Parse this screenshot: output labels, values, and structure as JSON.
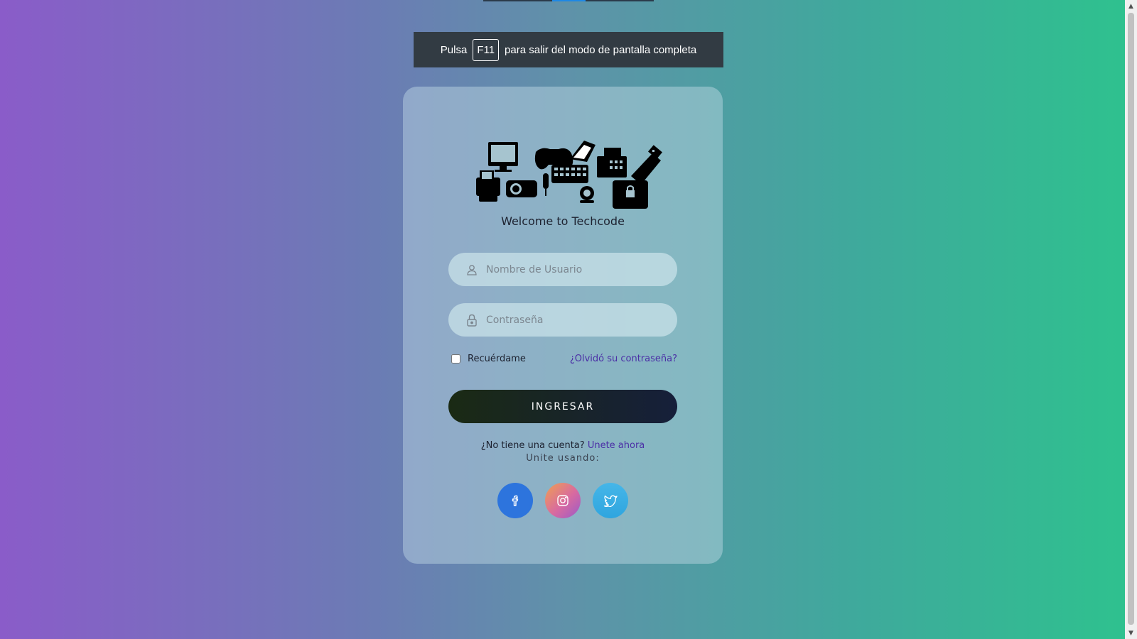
{
  "fullscreen_banner": {
    "prefix": "Pulsa",
    "key": "F11",
    "suffix": "para salir del modo de pantalla completa"
  },
  "login": {
    "welcome": "Welcome to Techcode",
    "username_placeholder": "Nombre de Usuario",
    "password_placeholder": "Contraseña",
    "remember_label": "Recuérdame",
    "remember_checked": false,
    "forgot_link": "¿Olvidó su contraseña?",
    "submit_label": "INGRESAR",
    "no_account_text": "¿No tiene una cuenta?",
    "join_link": "Unete ahora",
    "join_using": "Unite usando:"
  },
  "social": [
    {
      "icon": "facebook-icon",
      "color": "#2d74dd"
    },
    {
      "icon": "instagram-icon",
      "color": "#d86aa0"
    },
    {
      "icon": "twitter-icon",
      "color": "#35abe2"
    }
  ],
  "colors": {
    "gradient_left": "#8a5cc9",
    "gradient_right": "#2ec28e",
    "link": "#4b2fa6",
    "button": "#161f3a"
  }
}
